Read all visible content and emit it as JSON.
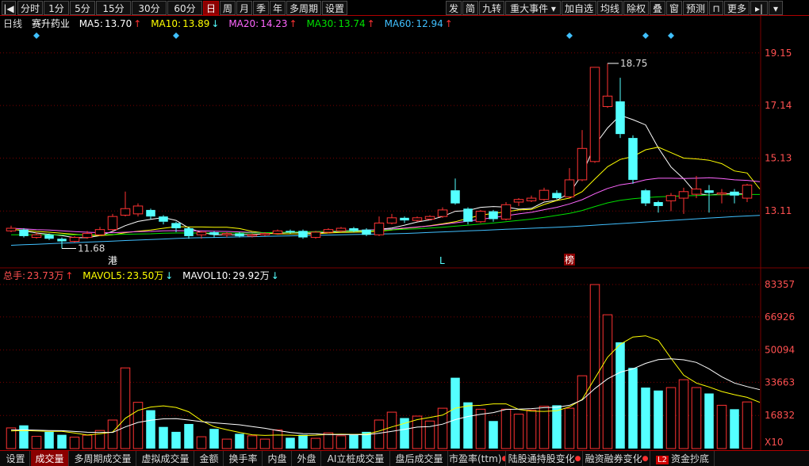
{
  "toolbar": {
    "left": [
      "分时",
      "1分",
      "5分",
      "15分",
      "30分",
      "60分",
      "日",
      "周",
      "月",
      "季",
      "年",
      "多周期",
      "设置"
    ],
    "right": [
      "发",
      "简",
      "九转",
      "重大事件",
      "加自选",
      "均线",
      "除权",
      "叠",
      "窗",
      "预测",
      "更多"
    ],
    "active": "日"
  },
  "main_header": {
    "period": "日线",
    "stock": "赛升药业",
    "ma": [
      {
        "label": "MA5:",
        "value": "13.70",
        "dir": "up",
        "color": "#ffffff"
      },
      {
        "label": "MA10:",
        "value": "13.89",
        "dir": "down",
        "color": "#ffff00"
      },
      {
        "label": "MA20:",
        "value": "14.23",
        "dir": "up",
        "color": "#ff66ff"
      },
      {
        "label": "MA30:",
        "value": "13.74",
        "dir": "up",
        "color": "#00e000"
      },
      {
        "label": "MA60:",
        "value": "12.94",
        "dir": "up",
        "color": "#40c0ff"
      }
    ]
  },
  "vol_header": {
    "total_label": "总手:",
    "total_value": "23.73万",
    "total_dir": "up",
    "mavol5_label": "MAVOL5:",
    "mavol5_value": "23.50万",
    "mavol5_dir": "down",
    "mavol10_label": "MAVOL10:",
    "mavol10_value": "29.92万",
    "mavol10_dir": "down"
  },
  "price_axis_labels": [
    "19.15",
    "17.14",
    "15.13",
    "13.11"
  ],
  "volume_axis_labels": [
    "83357",
    "66926",
    "50094",
    "33663",
    "16832"
  ],
  "volume_unit": "X10",
  "annotations": {
    "high": "18.75",
    "low": "11.68",
    "marker_gang": "港",
    "marker_L": "L",
    "marker_bang": "榜"
  },
  "bottom_tabs": [
    {
      "label": "设置",
      "active": false,
      "dot": false
    },
    {
      "label": "成交量",
      "active": true,
      "dot": false
    },
    {
      "label": "多周期成交量",
      "active": false,
      "dot": false
    },
    {
      "label": "虚拟成交量",
      "active": false,
      "dot": false
    },
    {
      "label": "金额",
      "active": false,
      "dot": false
    },
    {
      "label": "换手率",
      "active": false,
      "dot": false
    },
    {
      "label": "内盘",
      "active": false,
      "dot": false
    },
    {
      "label": "外盘",
      "active": false,
      "dot": false
    },
    {
      "label": "AI立桩成交量",
      "active": false,
      "dot": false
    },
    {
      "label": "盘后成交量",
      "active": false,
      "dot": false
    },
    {
      "label": "市盈率(ttm)",
      "active": false,
      "dot": true
    },
    {
      "label": "陆股通持股变化",
      "active": false,
      "dot": true
    },
    {
      "label": "融资融券变化",
      "active": false,
      "dot": true
    },
    {
      "label": "资金抄底",
      "active": false,
      "dot": false,
      "l2": "L2"
    }
  ],
  "colors": {
    "up": "#ff3232",
    "down": "#54ffff",
    "grid": "#7a0000",
    "axis_text": "#ff5050"
  },
  "chart_data": {
    "type": "candlestick",
    "ylim_price": [
      11.3,
      19.9
    ],
    "ylim_volume": [
      0,
      87000
    ],
    "candles": [
      {
        "o": 12.35,
        "c": 12.45,
        "h": 12.55,
        "l": 12.3,
        "v": 10500
      },
      {
        "o": 12.4,
        "c": 12.15,
        "h": 12.45,
        "l": 12.1,
        "v": 11800
      },
      {
        "o": 12.1,
        "c": 12.2,
        "h": 12.3,
        "l": 12.05,
        "v": 6200
      },
      {
        "o": 12.2,
        "c": 12.05,
        "h": 12.25,
        "l": 12.0,
        "v": 8500
      },
      {
        "o": 12.05,
        "c": 11.95,
        "h": 12.1,
        "l": 11.68,
        "v": 7000
      },
      {
        "o": 11.95,
        "c": 12.1,
        "h": 12.15,
        "l": 11.9,
        "v": 5800
      },
      {
        "o": 12.1,
        "c": 12.25,
        "h": 12.35,
        "l": 12.05,
        "v": 6800
      },
      {
        "o": 12.2,
        "c": 12.4,
        "h": 12.5,
        "l": 12.15,
        "v": 9200
      },
      {
        "o": 12.4,
        "c": 12.9,
        "h": 13.0,
        "l": 12.35,
        "v": 14500
      },
      {
        "o": 12.95,
        "c": 13.2,
        "h": 13.85,
        "l": 12.9,
        "v": 41000
      },
      {
        "o": 13.0,
        "c": 13.3,
        "h": 13.4,
        "l": 12.9,
        "v": 23500
      },
      {
        "o": 13.15,
        "c": 12.9,
        "h": 13.2,
        "l": 12.8,
        "v": 19500
      },
      {
        "o": 12.9,
        "c": 12.7,
        "h": 12.95,
        "l": 12.6,
        "v": 11000
      },
      {
        "o": 12.65,
        "c": 12.45,
        "h": 12.7,
        "l": 12.3,
        "v": 8500
      },
      {
        "o": 12.45,
        "c": 12.15,
        "h": 12.5,
        "l": 12.05,
        "v": 12500
      },
      {
        "o": 12.2,
        "c": 12.3,
        "h": 12.35,
        "l": 12.05,
        "v": 6000
      },
      {
        "o": 12.3,
        "c": 12.2,
        "h": 12.35,
        "l": 12.1,
        "v": 10000
      },
      {
        "o": 12.2,
        "c": 12.25,
        "h": 12.3,
        "l": 12.1,
        "v": 4800
      },
      {
        "o": 12.25,
        "c": 12.15,
        "h": 12.3,
        "l": 12.1,
        "v": 7500
      },
      {
        "o": 12.15,
        "c": 12.2,
        "h": 12.25,
        "l": 12.1,
        "v": 6500
      },
      {
        "o": 12.2,
        "c": 12.25,
        "h": 12.3,
        "l": 12.15,
        "v": 4800
      },
      {
        "o": 12.25,
        "c": 12.35,
        "h": 12.4,
        "l": 12.2,
        "v": 9500
      },
      {
        "o": 12.35,
        "c": 12.3,
        "h": 12.4,
        "l": 12.25,
        "v": 5500
      },
      {
        "o": 12.35,
        "c": 12.1,
        "h": 12.4,
        "l": 12.05,
        "v": 7000
      },
      {
        "o": 12.1,
        "c": 12.3,
        "h": 12.35,
        "l": 12.05,
        "v": 5200
      },
      {
        "o": 12.3,
        "c": 12.4,
        "h": 12.45,
        "l": 12.25,
        "v": 8000
      },
      {
        "o": 12.35,
        "c": 12.45,
        "h": 12.5,
        "l": 12.3,
        "v": 6500
      },
      {
        "o": 12.45,
        "c": 12.35,
        "h": 12.5,
        "l": 12.3,
        "v": 7000
      },
      {
        "o": 12.4,
        "c": 12.2,
        "h": 12.45,
        "l": 12.15,
        "v": 8500
      },
      {
        "o": 12.2,
        "c": 12.65,
        "h": 12.9,
        "l": 12.15,
        "v": 14500
      },
      {
        "o": 12.65,
        "c": 12.85,
        "h": 13.0,
        "l": 12.6,
        "v": 18500
      },
      {
        "o": 12.85,
        "c": 12.75,
        "h": 12.9,
        "l": 12.65,
        "v": 15500
      },
      {
        "o": 12.75,
        "c": 12.85,
        "h": 12.9,
        "l": 12.7,
        "v": 16500
      },
      {
        "o": 12.8,
        "c": 12.9,
        "h": 12.95,
        "l": 12.75,
        "v": 14000
      },
      {
        "o": 12.9,
        "c": 13.15,
        "h": 13.25,
        "l": 12.85,
        "v": 20500
      },
      {
        "o": 13.9,
        "c": 13.4,
        "h": 14.35,
        "l": 13.35,
        "v": 36000
      },
      {
        "o": 13.2,
        "c": 12.7,
        "h": 13.25,
        "l": 12.6,
        "v": 23500
      },
      {
        "o": 12.7,
        "c": 13.1,
        "h": 13.15,
        "l": 12.65,
        "v": 20000
      },
      {
        "o": 13.1,
        "c": 12.8,
        "h": 13.15,
        "l": 12.7,
        "v": 14000
      },
      {
        "o": 12.8,
        "c": 13.35,
        "h": 13.45,
        "l": 12.75,
        "v": 20000
      },
      {
        "o": 13.45,
        "c": 13.55,
        "h": 13.6,
        "l": 13.3,
        "v": 17500
      },
      {
        "o": 13.5,
        "c": 13.6,
        "h": 13.7,
        "l": 13.45,
        "v": 19500
      },
      {
        "o": 13.55,
        "c": 13.9,
        "h": 14.0,
        "l": 13.5,
        "v": 21500
      },
      {
        "o": 13.8,
        "c": 13.6,
        "h": 13.9,
        "l": 13.55,
        "v": 22000
      },
      {
        "o": 13.65,
        "c": 14.3,
        "h": 14.75,
        "l": 13.6,
        "v": 20500
      },
      {
        "o": 14.3,
        "c": 15.5,
        "h": 16.2,
        "l": 14.25,
        "v": 37000
      },
      {
        "o": 15.0,
        "c": 18.6,
        "h": 18.6,
        "l": 14.95,
        "v": 83357
      },
      {
        "o": 17.1,
        "c": 17.5,
        "h": 18.75,
        "l": 17.05,
        "v": 68000
      },
      {
        "o": 17.3,
        "c": 16.05,
        "h": 18.2,
        "l": 15.9,
        "v": 54000
      },
      {
        "o": 15.9,
        "c": 14.3,
        "h": 16.0,
        "l": 14.15,
        "v": 41000
      },
      {
        "o": 13.9,
        "c": 13.4,
        "h": 13.95,
        "l": 13.3,
        "v": 31000
      },
      {
        "o": 13.45,
        "c": 13.3,
        "h": 13.5,
        "l": 13.05,
        "v": 29500
      },
      {
        "o": 13.5,
        "c": 13.7,
        "h": 13.8,
        "l": 13.1,
        "v": 31000
      },
      {
        "o": 13.6,
        "c": 13.85,
        "h": 14.0,
        "l": 13.0,
        "v": 35000
      },
      {
        "o": 13.75,
        "c": 13.95,
        "h": 14.45,
        "l": 13.6,
        "v": 31000
      },
      {
        "o": 13.9,
        "c": 13.8,
        "h": 14.1,
        "l": 13.05,
        "v": 28000
      },
      {
        "o": 13.75,
        "c": 13.8,
        "h": 13.95,
        "l": 13.4,
        "v": 22000
      },
      {
        "o": 13.85,
        "c": 13.7,
        "h": 13.95,
        "l": 13.4,
        "v": 20000
      },
      {
        "o": 13.6,
        "c": 14.1,
        "h": 14.15,
        "l": 13.45,
        "v": 23700
      }
    ],
    "ma_lines": {
      "ma5": [
        12.42,
        12.35,
        12.27,
        12.22,
        12.17,
        12.09,
        12.09,
        12.17,
        12.33,
        12.55,
        12.71,
        12.79,
        12.86,
        12.75,
        12.46,
        12.29,
        12.2,
        12.2,
        12.2,
        12.21,
        12.24,
        12.26,
        12.29,
        12.28,
        12.26,
        12.3,
        12.33,
        12.34,
        12.34,
        12.41,
        12.46,
        12.57,
        12.69,
        12.77,
        12.9,
        13.1,
        13.13,
        13.25,
        13.28,
        13.26,
        13.18,
        13.21,
        13.45,
        13.52,
        13.79,
        14.51,
        15.63,
        16.28,
        16.77,
        16.6,
        16.4,
        15.52,
        14.79,
        14.34,
        13.77,
        13.72,
        13.76,
        13.77,
        13.75
      ],
      "ma10": [
        12.4,
        12.38,
        12.33,
        12.3,
        12.26,
        12.22,
        12.18,
        12.17,
        12.2,
        12.28,
        12.34,
        12.38,
        12.45,
        12.51,
        12.5,
        12.5,
        12.49,
        12.49,
        12.44,
        12.33,
        12.27,
        12.23,
        12.24,
        12.23,
        12.24,
        12.27,
        12.29,
        12.3,
        12.31,
        12.34,
        12.38,
        12.45,
        12.49,
        12.55,
        12.62,
        12.7,
        12.83,
        12.95,
        13.02,
        13.08,
        13.15,
        13.17,
        13.36,
        13.51,
        13.6,
        13.85,
        14.33,
        14.8,
        15.08,
        15.19,
        15.45,
        15.55,
        15.34,
        15.13,
        15.1,
        15.05,
        14.92,
        14.64,
        14.56,
        13.95
      ],
      "ma20": [
        12.45,
        12.43,
        12.4,
        12.38,
        12.35,
        12.32,
        12.3,
        12.28,
        12.28,
        12.3,
        12.32,
        12.33,
        12.35,
        12.36,
        12.35,
        12.35,
        12.34,
        12.33,
        12.31,
        12.29,
        12.28,
        12.28,
        12.3,
        12.31,
        12.32,
        12.33,
        12.35,
        12.37,
        12.38,
        12.4,
        12.42,
        12.46,
        12.5,
        12.54,
        12.6,
        12.66,
        12.72,
        12.79,
        12.86,
        12.93,
        13.0,
        13.06,
        13.16,
        13.25,
        13.38,
        13.54,
        13.77,
        13.97,
        14.11,
        14.18,
        14.3,
        14.36,
        14.36,
        14.35,
        14.36,
        14.38,
        14.35,
        14.3,
        14.28,
        14.23
      ],
      "ma30": [
        12.2,
        12.2,
        12.2,
        12.2,
        12.2,
        12.2,
        12.2,
        12.2,
        12.21,
        12.22,
        12.23,
        12.24,
        12.26,
        12.27,
        12.27,
        12.27,
        12.27,
        12.27,
        12.27,
        12.27,
        12.28,
        12.29,
        12.3,
        12.31,
        12.32,
        12.33,
        12.34,
        12.35,
        12.36,
        12.37,
        12.39,
        12.41,
        12.43,
        12.46,
        12.49,
        12.53,
        12.57,
        12.61,
        12.65,
        12.7,
        12.75,
        12.8,
        12.87,
        12.94,
        13.02,
        13.13,
        13.28,
        13.42,
        13.52,
        13.58,
        13.62,
        13.65,
        13.67,
        13.69,
        13.7,
        13.72,
        13.73,
        13.73,
        13.74,
        13.74
      ],
      "ma60": [
        11.8,
        11.82,
        11.84,
        11.86,
        11.88,
        11.9,
        11.92,
        11.94,
        11.96,
        11.98,
        12.0,
        12.02,
        12.04,
        12.06,
        12.08,
        12.09,
        12.1,
        12.11,
        12.12,
        12.13,
        12.14,
        12.15,
        12.16,
        12.17,
        12.18,
        12.19,
        12.2,
        12.21,
        12.22,
        12.23,
        12.24,
        12.25,
        12.27,
        12.29,
        12.31,
        12.33,
        12.35,
        12.37,
        12.39,
        12.41,
        12.43,
        12.45,
        12.47,
        12.49,
        12.51,
        12.54,
        12.57,
        12.6,
        12.63,
        12.66,
        12.69,
        12.72,
        12.75,
        12.78,
        12.81,
        12.84,
        12.87,
        12.9,
        12.92,
        12.94
      ]
    },
    "mavol_lines": {
      "mavol5": [
        9000,
        9200,
        9000,
        8800,
        8800,
        7900,
        6900,
        7500,
        8400,
        15400,
        19400,
        21100,
        21700,
        20900,
        18700,
        14200,
        11100,
        9600,
        8200,
        7000,
        6700,
        6900,
        6800,
        6600,
        6800,
        7200,
        7300,
        7200,
        7300,
        8900,
        11000,
        12800,
        14700,
        15800,
        17000,
        20500,
        21700,
        22000,
        22700,
        22700,
        19900,
        19000,
        18900,
        19200,
        21200,
        25000,
        35700,
        46400,
        53000,
        56700,
        57300,
        55000,
        45900,
        37300,
        33300,
        31300,
        29000,
        27400,
        26000,
        23500
      ],
      "mavol10": [
        9500,
        9500,
        9400,
        9200,
        9100,
        8700,
        8300,
        8200,
        8200,
        11000,
        13300,
        14400,
        15100,
        15200,
        14500,
        13700,
        13100,
        12600,
        12100,
        11200,
        10300,
        9200,
        8200,
        7600,
        7500,
        7100,
        7100,
        7100,
        7000,
        7800,
        8800,
        9800,
        10900,
        11200,
        12400,
        14700,
        16300,
        17400,
        18300,
        19900,
        20000,
        20300,
        20800,
        21000,
        22000,
        24700,
        30500,
        35400,
        38800,
        40500,
        43300,
        45200,
        45600,
        45100,
        43800,
        40500,
        36500,
        33300,
        31500,
        29920
      ]
    },
    "price_ticks": [
      19.15,
      17.14,
      15.13,
      13.11
    ],
    "volume_ticks": [
      83357,
      66926,
      50094,
      33663,
      16832
    ],
    "high_index": 47,
    "low_index": 4,
    "marker_indices": {
      "gang": 8,
      "L": 34,
      "bang": 44
    },
    "diamond_indices": [
      2,
      13,
      44,
      50,
      52
    ]
  }
}
